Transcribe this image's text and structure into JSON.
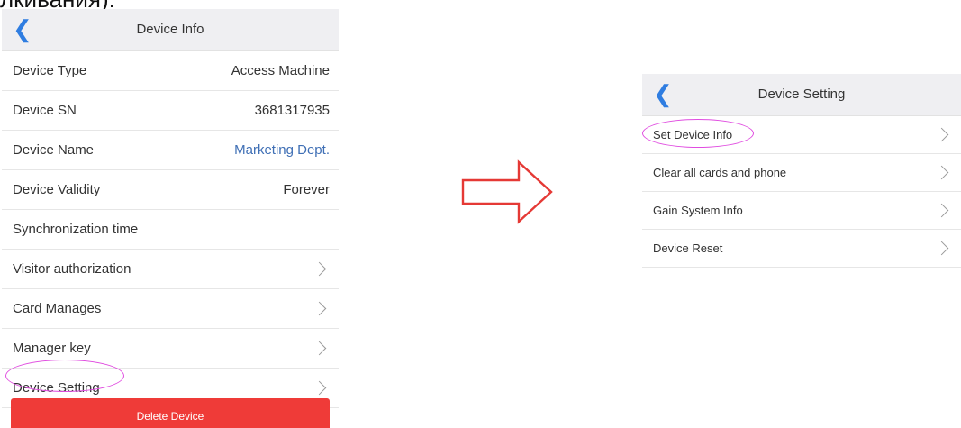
{
  "partial_caption": "лкивания).",
  "left": {
    "title": "Device Info",
    "rows": [
      {
        "label": "Device Type",
        "value": "Access Machine"
      },
      {
        "label": "Device SN",
        "value": "3681317935"
      },
      {
        "label": "Device Name",
        "value": "Marketing Dept."
      },
      {
        "label": "Device Validity",
        "value": "Forever"
      },
      {
        "label": "Synchronization time",
        "value": ""
      },
      {
        "label": "Visitor authorization"
      },
      {
        "label": "Card Manages"
      },
      {
        "label": "Manager key"
      },
      {
        "label": "Device Setting"
      }
    ],
    "delete_label": "Delete Device"
  },
  "right": {
    "title": "Device Setting",
    "rows": [
      {
        "label": "Set Device Info"
      },
      {
        "label": "Clear all cards and phone"
      },
      {
        "label": "Gain System Info"
      },
      {
        "label": "Device Reset"
      }
    ]
  },
  "colors": {
    "accent": "#2f7de1",
    "highlight_oval": "#e04ce0",
    "arrow": "#e53935",
    "delete_button": "#ef3b38",
    "link_value": "#3f6fb5"
  }
}
